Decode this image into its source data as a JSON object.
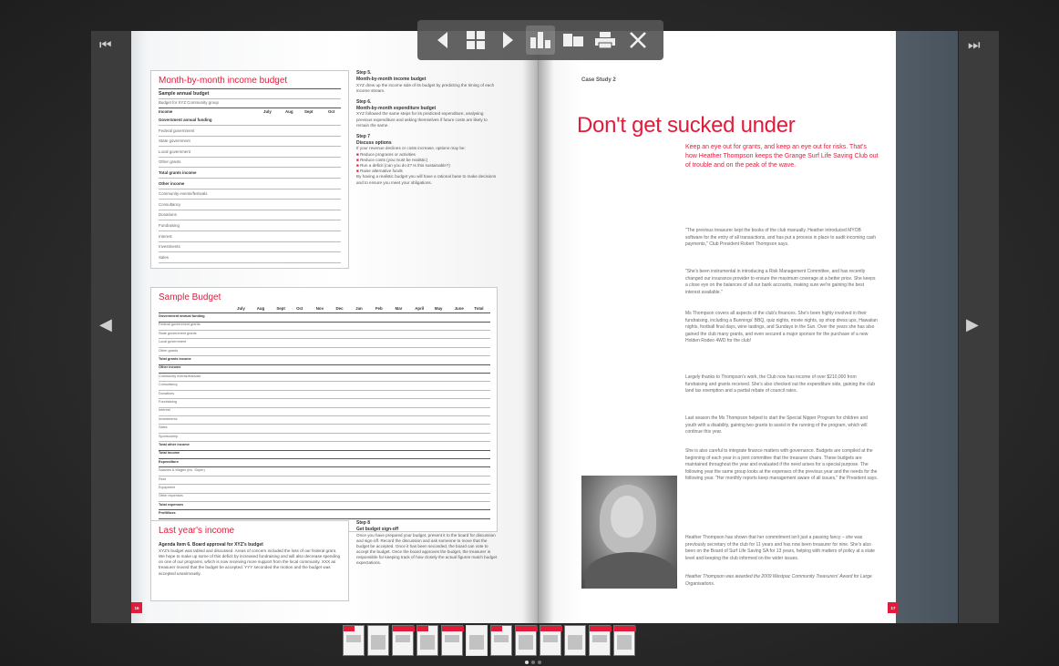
{
  "toolbar": {
    "buttons": [
      "previous",
      "thumbnails",
      "next",
      "page-view",
      "double-page",
      "print",
      "close"
    ]
  },
  "left_page": {
    "page_number": "16",
    "income_box": {
      "title": "Month-by-month income budget",
      "subtitle": "Sample annual budget",
      "caption": "Budget for XYZ Community group",
      "header": {
        "col0": "Income",
        "col1": "July",
        "col2": "Aug",
        "col3": "Sept",
        "col4": "Oct"
      },
      "rows": [
        {
          "label": "Government annual funding",
          "bold": true
        },
        {
          "label": "Federal government",
          "bold": false
        },
        {
          "label": "State government",
          "bold": false
        },
        {
          "label": "Local government",
          "bold": false
        },
        {
          "label": "Other grants",
          "bold": false
        },
        {
          "label": "Total grants income",
          "bold": true
        },
        {
          "label": "Other income",
          "bold": true
        },
        {
          "label": "Community events/festivals",
          "bold": false
        },
        {
          "label": "Consultancy",
          "bold": false
        },
        {
          "label": "Donations",
          "bold": false
        },
        {
          "label": "Fundraising",
          "bold": false
        },
        {
          "label": "Interest",
          "bold": false
        },
        {
          "label": "Investments",
          "bold": false
        },
        {
          "label": "Sales",
          "bold": false
        }
      ]
    },
    "steps_top": {
      "step5_title": "Step 5.",
      "step5_sub": "Month-by-month income budget",
      "step5_text": "XYZ drew up the income side of its budget by predicting the timing of each income stream.",
      "step6_title": "Step 6.",
      "step6_sub": "Month-by-month expenditure budget",
      "step6_text": "XYZ followed the same steps for its predicted expenditure, analysing previous expenditure and asking themselves if future costs are likely to remain the same.",
      "step7_title": "Step 7",
      "step7_sub": "Discuss options",
      "step7_text": "If your revenue declines or costs increase, options may be:",
      "bullets": [
        "Reduce programs or activities",
        "Reduce costs (you must be realistic)",
        "Run a deficit (can you do it? Is this sustainable?)",
        "Raise alternative funds"
      ],
      "step7_footer": "By having a realistic budget you will have a rational base to make decisions and to ensure you meet your obligations."
    },
    "sample_budget": {
      "title": "Sample Budget",
      "months": [
        "July",
        "Aug",
        "Sept",
        "Oct",
        "Nov",
        "Dec",
        "Jan",
        "Feb",
        "Mar",
        "April",
        "May",
        "June",
        "Total"
      ],
      "row_labels": [
        "Government annual funding",
        "Federal government grants",
        "State government grants",
        "Local government",
        "Other grants",
        "Total grants income",
        "Other income",
        "Community events/festivals",
        "Consultancy",
        "Donations",
        "Fundraising",
        "Interest",
        "Investments",
        "Sales",
        "Sponsorship",
        "Total other income",
        "Total income",
        "Expenditure",
        "Salaries & Wages (inc. Super)",
        "Rent",
        "Equipment",
        "Other expenses",
        "Total expenses",
        "Profit/loss"
      ]
    },
    "last_year": {
      "title": "Last year's income",
      "agenda": "Agenda Item 6. Board approval for XYZ's budget",
      "text": "XYZ's budget was tabled and discussed. Areas of concern included the loss of our federal grant. We hope to make up some of this deficit by increased fundraising and will also decrease spending on one of our programs, which is now receiving more support from the local community. XXX as treasurer moved that the budget be accepted. YYY seconded the motion and the budget was accepted unanimously."
    },
    "step8": {
      "title": "Step 8",
      "sub": "Get budget sign-off",
      "text": "Once you have prepared your budget, present it to the board for discussion and sign-off. Record the discussion and ask someone to move that the budget be accepted. Once it has been seconded, the board can vote to accept the budget. Once the board approves the budget, the treasurer is responsible for keeping track of how closely the actual figures match budget expectations."
    }
  },
  "right_page": {
    "page_number": "17",
    "case_label": "Case Study 2",
    "headline": "Don't get sucked under",
    "intro": "Keep an eye out for grants, and keep an eye out for risks. That's how Heather Thompson keeps the Grange Surf Life Saving Club out of trouble and on the peak of the wave.",
    "paragraphs": [
      "\"The previous treasurer kept the books of the club manually. Heather introduced MYOB software for the entry of all transactions, and has put a process in place to audit incoming cash payments,\" Club President Robert Thompson says.",
      "\"She's been instrumental in introducing a Risk Management Committee, and has recently changed our insurance provider to ensure the maximum coverage at a better price. She keeps a close eye on the balances of all our bank accounts, making sure we're gaining the best interest available.\"",
      "Ms Thompson covers all aspects of the club's finances. She's been highly involved in their fundraising, including a Bunnings' BBQ, quiz nights, movie nights, op shop dress ups, Hawaiian nights, football final days, wine tastings, and Sundays in the Sun. Over the years she has also gained the club many grants, and even secured a major sponsor for the purchase of a new Holden Rodeo 4WD for the club!",
      "Largely thanks to Thompson's work, the Club now has income of over $210,000 from fundraising and grants received. She's also checked out the expenditure side, gaining the club land tax exemption and a partial rebate of council rates.",
      "Last season the Ms Thompson helped to start the Special Nipper Program for children and youth with a disability, gaining two grants to assist in the running of the program, which will continue this year.",
      "She is also careful to integrate finance matters with governance. Budgets are compiled at the beginning of each year in a joint committee that the treasurer chairs. These budgets are maintained throughout the year and evaluated if the need arises for a special purpose. The following year the same group looks at the expenses of the previous year and the needs for the following year. \"Her monthly reports keep management aware of all issues,\" the President says.",
      "Heather Thompson has shown that her commitment isn't just a passing fancy – she was previously secretary of the club for 11 years and has now been treasurer for nine. She's also been on the Board of Surf Life Saving SA for 13 years, helping with matters of policy at a state level and keeping the club informed on the wider issues.",
      "Heather Thompson was awarded the 2009 Westpac Community Treasurers' Award for Large Organisations."
    ]
  },
  "thumbnails": {
    "count": 12,
    "active_index": 5
  },
  "colors": {
    "accent": "#e31b3b",
    "chrome": "#2a2a2a",
    "toolbar": "#555555"
  }
}
